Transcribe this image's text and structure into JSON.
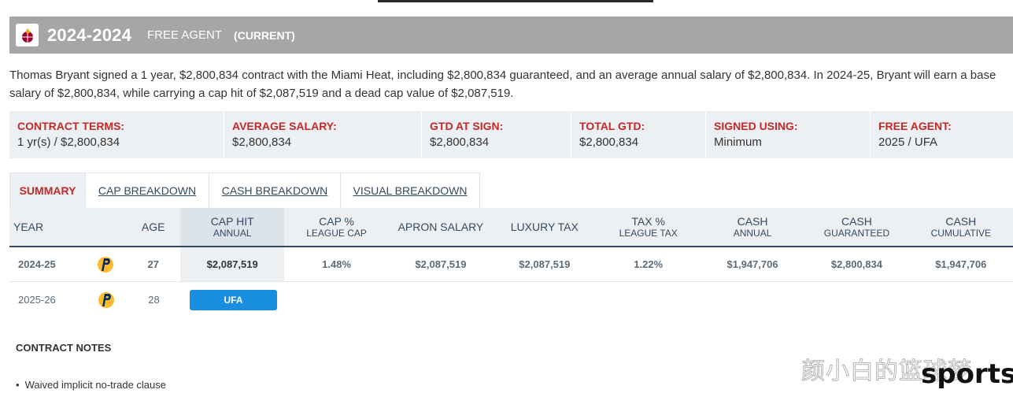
{
  "banner": {
    "year": "2024-2024",
    "type": "FREE AGENT",
    "status": "(CURRENT)"
  },
  "description": "Thomas Bryant signed a 1 year, $2,800,834 contract with the Miami Heat, including $2,800,834 guaranteed, and an average annual salary of $2,800,834. In 2024-25, Bryant will earn a base salary of $2,800,834, while carrying a cap hit of $2,087,519 and a dead cap value of $2,087,519.",
  "terms": [
    {
      "label": "CONTRACT TERMS:",
      "value": "1 yr(s) / $2,800,834"
    },
    {
      "label": "AVERAGE SALARY:",
      "value": "$2,800,834"
    },
    {
      "label": "GTD AT SIGN:",
      "value": "$2,800,834"
    },
    {
      "label": "TOTAL GTD:",
      "value": "$2,800,834"
    },
    {
      "label": "SIGNED USING:",
      "value": "Minimum"
    },
    {
      "label": "FREE AGENT:",
      "value": "2025 / UFA"
    }
  ],
  "tabs": [
    "SUMMARY",
    "CAP BREAKDOWN",
    "CASH BREAKDOWN",
    "VISUAL BREAKDOWN"
  ],
  "table": {
    "headers": [
      {
        "l1": "YEAR",
        "l2": ""
      },
      {
        "l1": "",
        "l2": ""
      },
      {
        "l1": "AGE",
        "l2": ""
      },
      {
        "l1": "CAP HIT",
        "l2": "ANNUAL"
      },
      {
        "l1": "CAP %",
        "l2": "LEAGUE CAP"
      },
      {
        "l1": "APRON SALARY",
        "l2": ""
      },
      {
        "l1": "LUXURY TAX",
        "l2": ""
      },
      {
        "l1": "TAX %",
        "l2": "LEAGUE TAX"
      },
      {
        "l1": "CASH",
        "l2": "ANNUAL"
      },
      {
        "l1": "CASH",
        "l2": "GUARANTEED"
      },
      {
        "l1": "CASH",
        "l2": "CUMULATIVE"
      }
    ],
    "rows": [
      {
        "year": "2024-25",
        "age": "27",
        "cap_hit": "$2,087,519",
        "cap_pct": "1.48%",
        "apron": "$2,087,519",
        "lux_tax": "$2,087,519",
        "tax_pct": "1.22%",
        "cash_annual": "$1,947,706",
        "cash_gtd": "$2,800,834",
        "cash_cum": "$1,947,706"
      },
      {
        "year": "2025-26",
        "age": "28",
        "status": "UFA"
      }
    ]
  },
  "notes": {
    "title": "CONTRACT NOTES",
    "items": [
      "Waived implicit no-trade clause"
    ]
  },
  "watermark": {
    "cn": "颜小白的篮球梦",
    "en": "sports"
  },
  "colors": {
    "accent_red": "#c62828",
    "navy": "#34495e",
    "ufa_blue": "#1a8ee0",
    "banner_gray": "#a6a6a6",
    "pacers_navy": "#002d62",
    "pacers_gold": "#fdbb30",
    "heat_red": "#98002e"
  }
}
